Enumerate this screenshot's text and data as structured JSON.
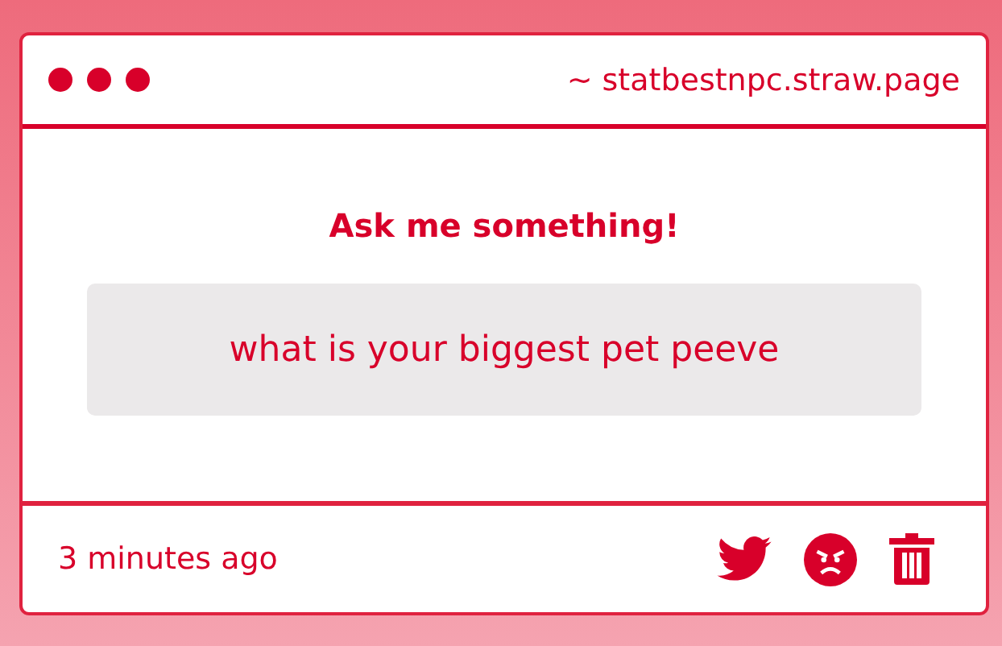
{
  "window": {
    "url": "~ statbestnpc.straw.page"
  },
  "prompt": {
    "title": "Ask me something!",
    "question": "what is your biggest pet peeve"
  },
  "footer": {
    "time": "3 minutes ago"
  }
}
